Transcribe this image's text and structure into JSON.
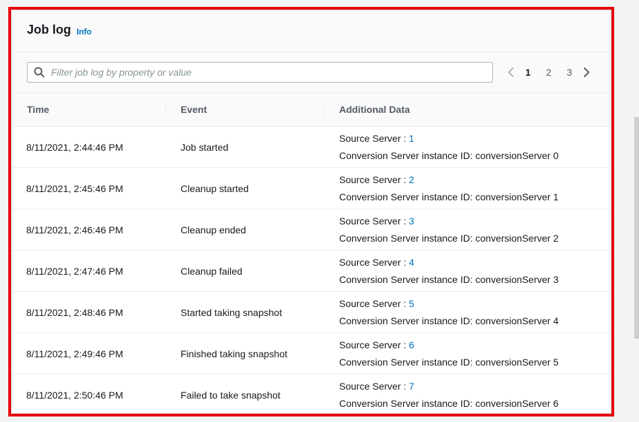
{
  "header": {
    "title": "Job log",
    "info_link": "Info"
  },
  "search": {
    "placeholder": "Filter job log by property or value",
    "value": ""
  },
  "pagination": {
    "pages": [
      "1",
      "2",
      "3"
    ],
    "current": "1"
  },
  "table": {
    "columns": [
      "Time",
      "Event",
      "Additional Data"
    ],
    "source_label": "Source Server : ",
    "conversion_label": "Conversion Server instance ID: ",
    "rows": [
      {
        "time": "8/11/2021, 2:44:46 PM",
        "event": "Job started",
        "source": "1",
        "conversion": "conversionServer 0"
      },
      {
        "time": "8/11/2021, 2:45:46 PM",
        "event": "Cleanup started",
        "source": "2",
        "conversion": "conversionServer 1"
      },
      {
        "time": "8/11/2021, 2:46:46 PM",
        "event": "Cleanup ended",
        "source": "3",
        "conversion": "conversionServer 2"
      },
      {
        "time": "8/11/2021, 2:47:46 PM",
        "event": "Cleanup failed",
        "source": "4",
        "conversion": "conversionServer 3"
      },
      {
        "time": "8/11/2021, 2:48:46 PM",
        "event": "Started taking snapshot",
        "source": "5",
        "conversion": "conversionServer 4"
      },
      {
        "time": "8/11/2021, 2:49:46 PM",
        "event": "Finished taking snapshot",
        "source": "6",
        "conversion": "conversionServer 5"
      },
      {
        "time": "8/11/2021, 2:50:46 PM",
        "event": "Failed to take snapshot",
        "source": "7",
        "conversion": "conversionServer 6"
      }
    ]
  },
  "colors": {
    "highlight_border": "#e8000b",
    "link": "#0073bb"
  },
  "icons": {
    "search": "search-icon",
    "prev": "chevron-left-icon",
    "next": "chevron-right-icon"
  }
}
